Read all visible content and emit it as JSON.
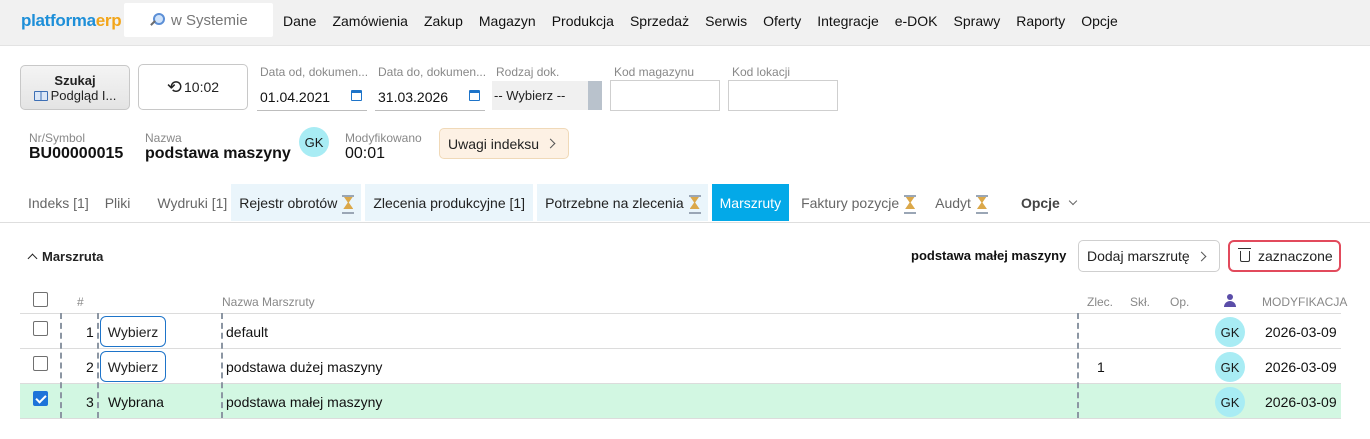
{
  "app": {
    "logo_main": "platforma",
    "logo_accent": "erp",
    "search_placeholder": "w Systemie"
  },
  "menu": [
    "Dane",
    "Zamówienia",
    "Zakup",
    "Magazyn",
    "Produkcja",
    "Sprzedaż",
    "Serwis",
    "Oferty",
    "Integracje",
    "e-DOK",
    "Sprawy",
    "Raporty",
    "Opcje"
  ],
  "filters": {
    "search_button": {
      "title": "Szukaj",
      "subtitle": "Podgląd I..."
    },
    "refresh_time": "10:02",
    "date_from": {
      "label": "Data od, dokumen...",
      "value": "01.04.2021"
    },
    "date_to": {
      "label": "Data do, dokumen...",
      "value": "31.03.2026"
    },
    "doc_type": {
      "label": "Rodzaj dok.",
      "value": "-- Wybierz --"
    },
    "warehouse_code": {
      "label": "Kod magazynu",
      "value": ""
    },
    "location_code": {
      "label": "Kod lokacji",
      "value": ""
    }
  },
  "record": {
    "symbol_label": "Nr/Symbol",
    "symbol": "BU00000015",
    "name_label": "Nazwa",
    "name": "podstawa maszyny",
    "user_initials": "GK",
    "modified_label": "Modyfikowano",
    "modified": "00:01",
    "notes_button": "Uwagi indeksu"
  },
  "tabs": [
    {
      "label": "Indeks [1]"
    },
    {
      "label": "Pliki"
    },
    {
      "label": "Wydruki [1]"
    },
    {
      "label": "Rejestr obrotów"
    },
    {
      "label": "Zlecenia produkcyjne [1]"
    },
    {
      "label": "Potrzebne na zlecenia"
    },
    {
      "label": "Marszruty"
    },
    {
      "label": "Faktury pozycje"
    },
    {
      "label": "Audyt"
    },
    {
      "label": "Opcje"
    }
  ],
  "section": {
    "title": "Marszruta",
    "selected_route": "podstawa małej maszyny",
    "add_button": "Dodaj marszrutę",
    "delete_button": "zaznaczone"
  },
  "table": {
    "columns": {
      "index": "#",
      "name": "Nazwa Marszruty",
      "zlec": "Zlec.",
      "skl": "Skł.",
      "op": "Op.",
      "modified": "MODYFIKACJA"
    },
    "rows": [
      {
        "index": "1",
        "action": "Wybierz",
        "name": "default",
        "zlec": "",
        "skl": "",
        "op": "",
        "user": "GK",
        "modified": "2026-03-09"
      },
      {
        "index": "2",
        "action": "Wybierz",
        "name": "podstawa dużej maszyny",
        "zlec": "1",
        "skl": "",
        "op": "",
        "user": "GK",
        "modified": "2026-03-09"
      },
      {
        "index": "3",
        "action": "Wybrana",
        "name": "podstawa małej maszyny",
        "zlec": "",
        "skl": "",
        "op": "",
        "user": "GK",
        "modified": "2026-03-09"
      }
    ]
  },
  "colors": {
    "active_tab": "#03a9e8",
    "selected_row": "#d2f7e2",
    "delete_border": "#e24a5c",
    "logo_blue": "#1e8fd8",
    "logo_orange": "#f2a51a"
  }
}
